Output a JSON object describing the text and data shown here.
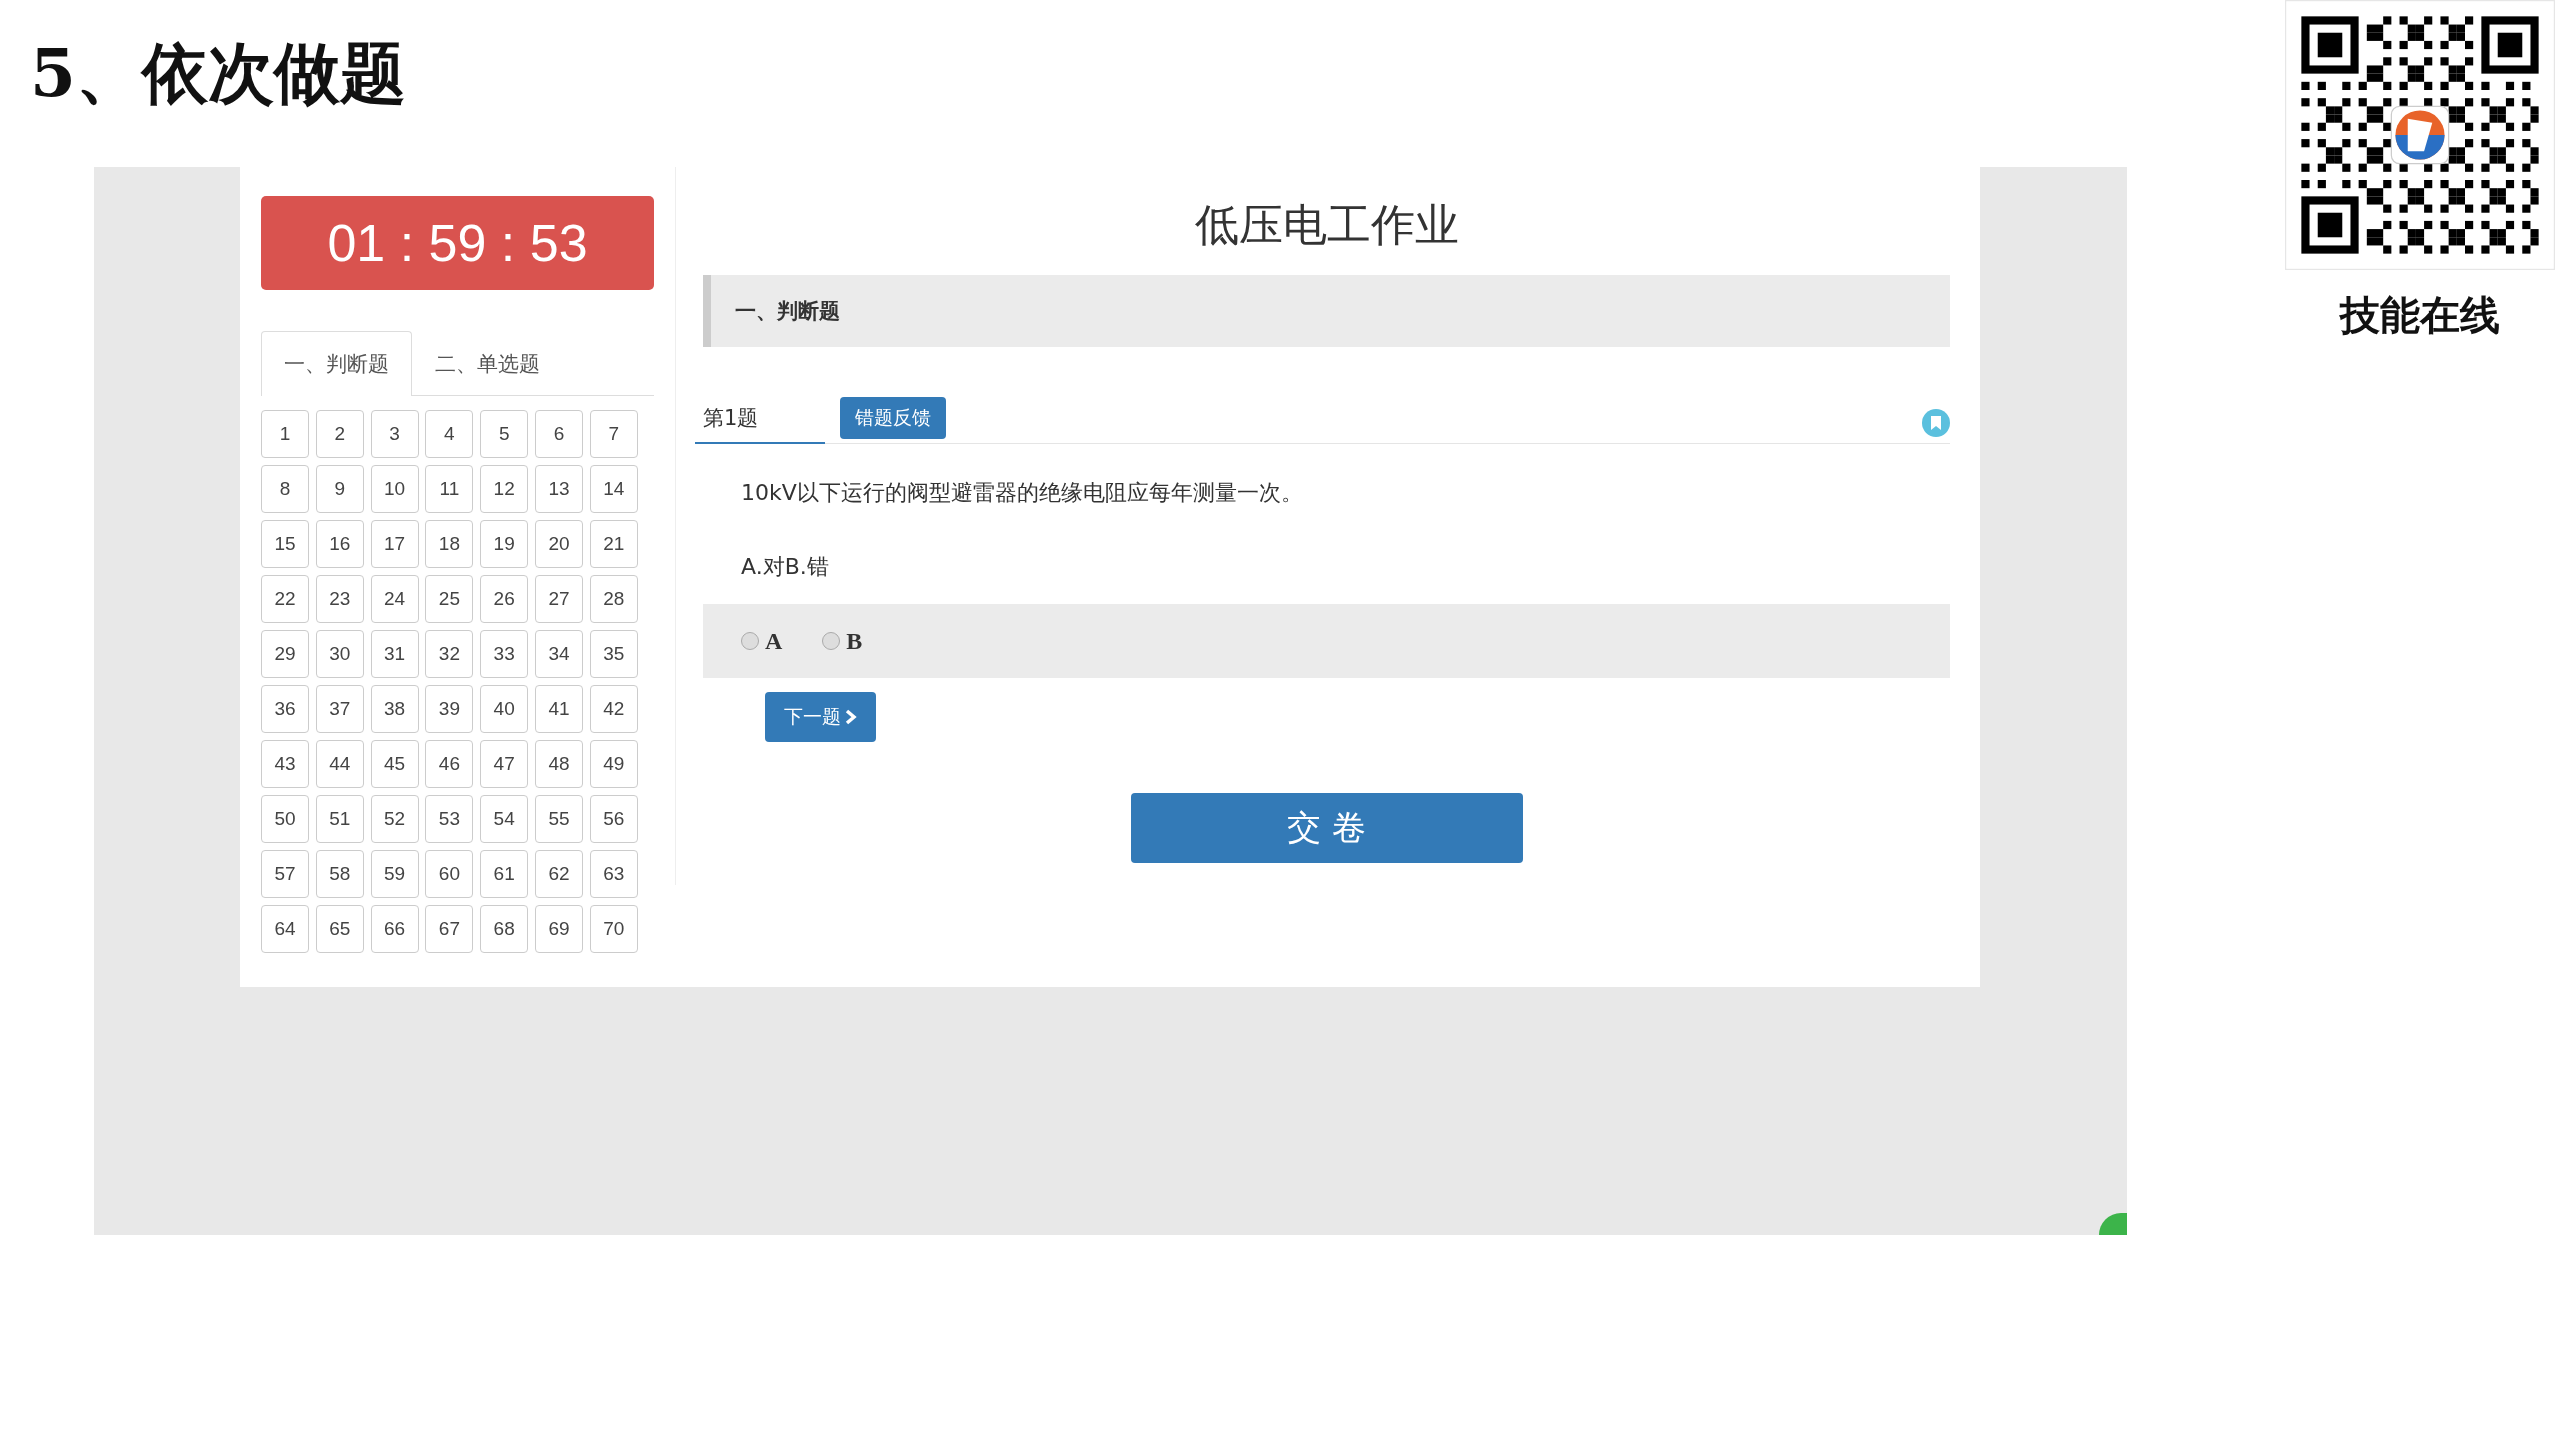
{
  "slide_title": "5、依次做题",
  "exam": {
    "timer": "01 : 59 : 53",
    "tabs": [
      {
        "label": "一、判断题",
        "selected": true
      },
      {
        "label": "二、单选题",
        "selected": false
      }
    ],
    "question_numbers": [
      "1",
      "2",
      "3",
      "4",
      "5",
      "6",
      "7",
      "8",
      "9",
      "10",
      "11",
      "12",
      "13",
      "14",
      "15",
      "16",
      "17",
      "18",
      "19",
      "20",
      "21",
      "22",
      "23",
      "24",
      "25",
      "26",
      "27",
      "28",
      "29",
      "30",
      "31",
      "32",
      "33",
      "34",
      "35",
      "36",
      "37",
      "38",
      "39",
      "40",
      "41",
      "42",
      "43",
      "44",
      "45",
      "46",
      "47",
      "48",
      "49",
      "50",
      "51",
      "52",
      "53",
      "54",
      "55",
      "56",
      "57",
      "58",
      "59",
      "60",
      "61",
      "62",
      "63",
      "64",
      "65",
      "66",
      "67",
      "68",
      "69",
      "70"
    ],
    "title": "低压电工作业",
    "section": "一、判断题",
    "question_label": "第1题",
    "feedback_button": "错题反馈",
    "question": "10kV以下运行的阀型避雷器的绝缘电阻应每年测量一次。",
    "options_text": "A.对B.错",
    "choices": [
      {
        "label": "A",
        "selected": false
      },
      {
        "label": "B",
        "selected": false
      }
    ],
    "next_button": "下一题",
    "submit_button": "交 卷"
  },
  "qr_caption": "技能在线"
}
